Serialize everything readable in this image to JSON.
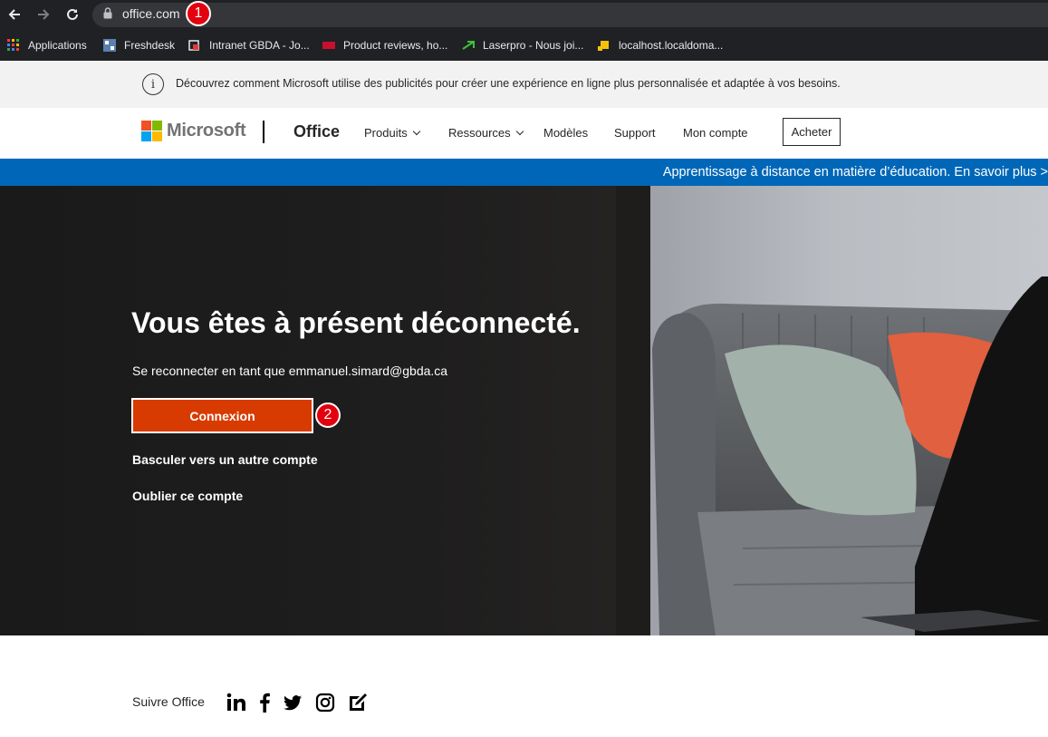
{
  "browser": {
    "url": "office.com",
    "annotations": [
      "1",
      "2"
    ],
    "bookmarks": [
      {
        "label": "Applications"
      },
      {
        "label": "Freshdesk"
      },
      {
        "label": "Intranet GBDA - Jo..."
      },
      {
        "label": "Product reviews, ho..."
      },
      {
        "label": "Laserpro - Nous joi..."
      },
      {
        "label": "localhost.localdoma..."
      }
    ]
  },
  "info_banner": {
    "text": "Découvrez comment Microsoft utilise des publicités pour créer une expérience en ligne plus personnalisée et adaptée à vos besoins."
  },
  "header": {
    "brand": "Microsoft",
    "product": "Office",
    "nav": [
      {
        "label": "Produits"
      },
      {
        "label": "Ressources"
      },
      {
        "label": "Modèles"
      },
      {
        "label": "Support"
      },
      {
        "label": "Mon compte"
      }
    ],
    "buy_label": "Acheter"
  },
  "ribbon": {
    "text": "Apprentissage à distance en matière d’éducation. En savoir plus >"
  },
  "hero": {
    "title": "Vous êtes à présent déconnecté.",
    "subtitle": "Se reconnecter en tant que emmanuel.simard@gbda.ca",
    "connect_label": "Connexion",
    "switch_label": "Basculer vers un autre compte",
    "forget_label": "Oublier ce compte"
  },
  "footer": {
    "follow_label": "Suivre Office",
    "social_icons": [
      "linkedin-icon",
      "facebook-icon",
      "twitter-icon",
      "instagram-icon",
      "blog-icon"
    ]
  },
  "colors": {
    "accent_orange": "#d83b01",
    "ribbon_blue": "#0067b8",
    "annotation_red": "#e3000f"
  }
}
